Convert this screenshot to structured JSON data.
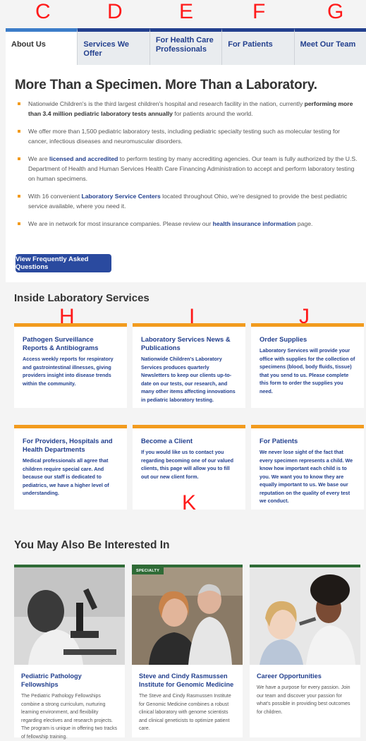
{
  "annotation_letters": [
    "C",
    "D",
    "E",
    "F",
    "G",
    "H",
    "I",
    "J",
    "K"
  ],
  "tabs": [
    {
      "label": "About Us",
      "active": true
    },
    {
      "label": "Services We Offer",
      "active": false
    },
    {
      "label": "For Health Care Professionals",
      "active": false
    },
    {
      "label": "For Patients",
      "active": false
    },
    {
      "label": "Meet Our Team",
      "active": false
    }
  ],
  "about": {
    "title": "More Than a Specimen. More Than a Laboratory.",
    "b1_pre": "Nationwide Children's is the third largest children's hospital and research facility in the nation, currently ",
    "b1_bold": "performing more than 3.4 million pediatric laboratory tests annually",
    "b1_post": " for patients around the world.",
    "b2": "We offer more than 1,500 pediatric laboratory tests, including pediatric specialty testing such as molecular testing for cancer, infectious diseases and neuromuscular disorders.",
    "b3_pre": "We are ",
    "b3_link": "licensed and accredited",
    "b3_post": " to perform testing by many accrediting agencies. Our team is fully authorized by the U.S. Department of Health and Human Services Health Care Financing Administration to accept and perform laboratory testing on human specimens.",
    "b4_pre": "With 16 convenient ",
    "b4_link": "Laboratory Service Centers",
    "b4_post": " located throughout Ohio, we're designed to provide the best pediatric service available, where you need it.",
    "b5_pre": "We are in network for most insurance companies. Please review our ",
    "b5_link": "health insurance information",
    "b5_post": " page.",
    "faq_button": "View Frequently Asked Questions"
  },
  "inside": {
    "title": "Inside Laboratory Services",
    "cards": [
      {
        "title": "Pathogen Surveillance Reports & Antibiograms",
        "text": "Access weekly reports for respiratory and gastrointestinal illnesses, giving providers insight into disease trends within the community."
      },
      {
        "title": "Laboratory Services News & Publications",
        "text": "Nationwide Children's Laboratory Services produces quarterly Newsletters to keep our clients up-to-date on our tests, our research, and many other items affecting innovations in pediatric laboratory testing."
      },
      {
        "title": "Order Supplies",
        "text": "Laboratory Services will provide your office with supplies for the collection of specimens (blood, body fluids, tissue) that you send to us. Please complete this form to order the supplies you need."
      },
      {
        "title": "For Providers, Hospitals and Health Departments",
        "text": "Medical professionals all agree that children require special care. And because our staff is dedicated to pediatrics, we have a higher level of understanding."
      },
      {
        "title": "Become a Client",
        "text": "If you would like us to contact you regarding becoming one of our valued clients, this page will allow you to fill out our new client form."
      },
      {
        "title": "For Patients",
        "text": "We never lose sight of the fact that every specimen represents a child. We know how important each child is to you. We want you to know they are equally important to us. We base our reputation on the quality of every test we conduct."
      }
    ]
  },
  "related": {
    "title": "You May Also Be Interested In",
    "items": [
      {
        "tag": "",
        "title": "Pediatric Pathology Fellowships",
        "text": "The Pediatric Pathology Fellowships combine a strong curriculum, nurturing learning environment, and flexibility regarding electives and research projects. The program is unique in offering two tracks of fellowship training."
      },
      {
        "tag": "SPECIALTY",
        "title": "Steve and Cindy Rasmussen Institute for Genomic Medicine",
        "text": "The Steve and Cindy Rasmussen Institute for Genomic Medicine combines a robust clinical laboratory with genome scientists and clinical geneticists to optimize patient care."
      },
      {
        "tag": "",
        "title": "Career Opportunities",
        "text": "We have a purpose for every passion. Join our team and discover your passion for what's possible in providing best outcomes for children."
      }
    ]
  }
}
